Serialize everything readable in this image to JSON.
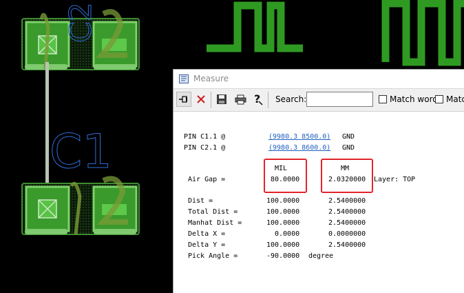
{
  "pcb": {
    "labels": {
      "c2_ref": "C2",
      "c1_ref": "C1",
      "pad_digit": "2"
    }
  },
  "window": {
    "title": "Measure",
    "toolbar": {
      "search_label": "Search:",
      "search_value": "",
      "match_word_label": "Match word",
      "match_case_label": "Match"
    }
  },
  "report": {
    "pins": [
      {
        "label": "PIN C1.1 @",
        "coord": "(9980.3 8500.0)",
        "net": "GND"
      },
      {
        "label": "PIN C2.1 @",
        "coord": "(9980.3 8600.0)",
        "net": "GND"
      }
    ],
    "units": {
      "mil": "MIL",
      "mm": "MM"
    },
    "air_gap": {
      "label": "Air Gap =",
      "mil": "80.0000",
      "mm": "2.0320000",
      "layer": "Layer: TOP"
    },
    "rows": [
      {
        "label": "Dist =",
        "mil": "100.0000",
        "mm": "2.5400000"
      },
      {
        "label": "Total Dist =",
        "mil": "100.0000",
        "mm": "2.5400000"
      },
      {
        "label": "Manhat Dist =",
        "mil": "100.0000",
        "mm": "2.5400000"
      },
      {
        "label": "Delta X =",
        "mil": "0.0000",
        "mm": "0.0000000"
      },
      {
        "label": "Delta Y =",
        "mil": "100.0000",
        "mm": "2.5400000"
      }
    ],
    "pick_angle": {
      "label": "Pick Angle =",
      "value": "-90.0000",
      "unit": "degree"
    }
  },
  "colors": {
    "background": "#000000",
    "pad_green": "#4fb83a",
    "pad_dark": "#2f7a25",
    "pad_outline": "#7fd36a",
    "trace_green": "#2f9a22",
    "silkscreen": "#2e6fd8",
    "highlight_box": "#e0242a",
    "link": "#1f5fc0"
  }
}
